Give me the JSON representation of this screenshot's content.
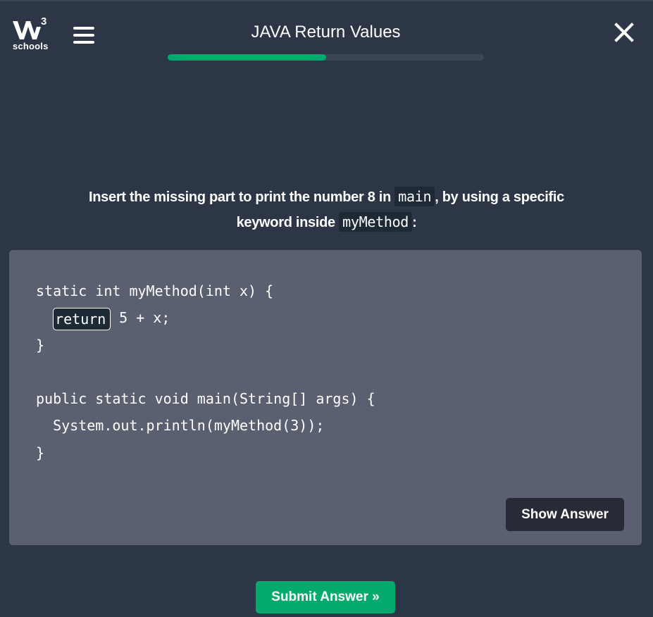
{
  "logo": {
    "text": "schools",
    "superscript": "3"
  },
  "header": {
    "title": "JAVA Return Values",
    "progress": 0.5
  },
  "question": {
    "part1": "Insert the missing part to print the number 8 in ",
    "kw1": "main",
    "part2": ", by using a specific",
    "part3": "keyword inside ",
    "kw2": "myMethod",
    "part4": ":"
  },
  "code": {
    "line1": "static int myMethod(int x) {",
    "line2_indent": "  ",
    "answer_value": "return",
    "line2_rest": " 5 + x;",
    "line3": "}",
    "line4": "",
    "line5": "public static void main(String[] args) {",
    "line6": "  System.out.println(myMethod(3));",
    "line7": "}"
  },
  "buttons": {
    "show_answer": "Show Answer",
    "submit": "Submit Answer »"
  },
  "colors": {
    "accent": "#04aa6d",
    "background": "#2d3646",
    "panel": "#5a6070"
  },
  "icons": {
    "menu": "hamburger-menu-icon",
    "close": "close-icon",
    "logo": "w3schools-logo"
  }
}
